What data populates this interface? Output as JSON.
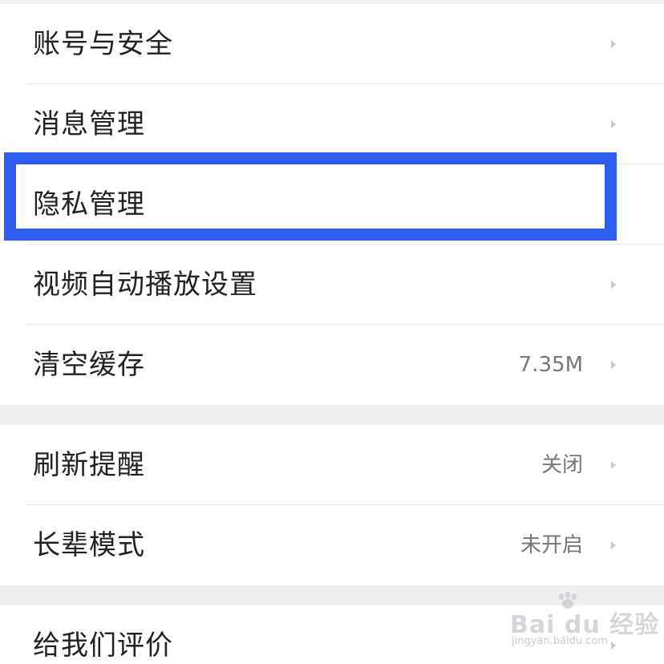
{
  "settings": {
    "group1": [
      {
        "label": "账号与安全",
        "value": ""
      },
      {
        "label": "消息管理",
        "value": ""
      },
      {
        "label": "隐私管理",
        "value": ""
      },
      {
        "label": "视频自动播放设置",
        "value": ""
      },
      {
        "label": "清空缓存",
        "value": "7.35M"
      }
    ],
    "group2": [
      {
        "label": "刷新提醒",
        "value": "关闭"
      },
      {
        "label": "长辈模式",
        "value": "未开启"
      }
    ],
    "group3": [
      {
        "label": "给我们评价",
        "value": ""
      }
    ]
  },
  "annotation": {
    "highlight_color": "#2f5df0",
    "highlighted_item": "隐私管理"
  },
  "watermark": {
    "main": "Bai du 经验",
    "sub": "jingyan.baidu.com"
  },
  "icons": {
    "row_chevron": "chevron-right-icon"
  }
}
